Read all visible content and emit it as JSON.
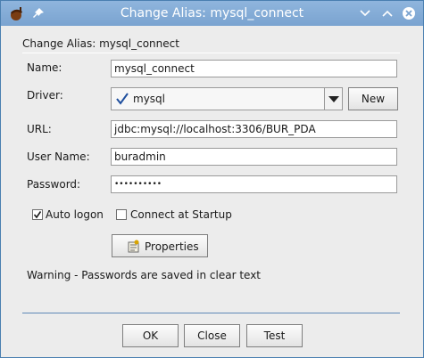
{
  "window": {
    "title": "Change Alias: mysql_connect"
  },
  "dialog": {
    "subtitle": "Change Alias: mysql_connect",
    "name": {
      "label": "Name:",
      "value": "mysql_connect"
    },
    "driver": {
      "label": "Driver:",
      "value": "mysql",
      "new_button": "New"
    },
    "url": {
      "label": "URL:",
      "value": "jdbc:mysql://localhost:3306/BUR_PDA"
    },
    "user": {
      "label": "User Name:",
      "value": "buradmin"
    },
    "password": {
      "label": "Password:",
      "value": "••••••••••"
    },
    "auto_logon": {
      "label": "Auto logon",
      "checked": true
    },
    "connect_startup": {
      "label": "Connect at Startup",
      "checked": false
    },
    "properties_button": "Properties",
    "warning": "Warning - Passwords are saved in clear text"
  },
  "buttons": {
    "ok": "OK",
    "close": "Close",
    "test": "Test"
  },
  "colors": {
    "titlebar": "#7aa3d0",
    "separator": "#5e88b7",
    "check": "#1a1a1a"
  }
}
